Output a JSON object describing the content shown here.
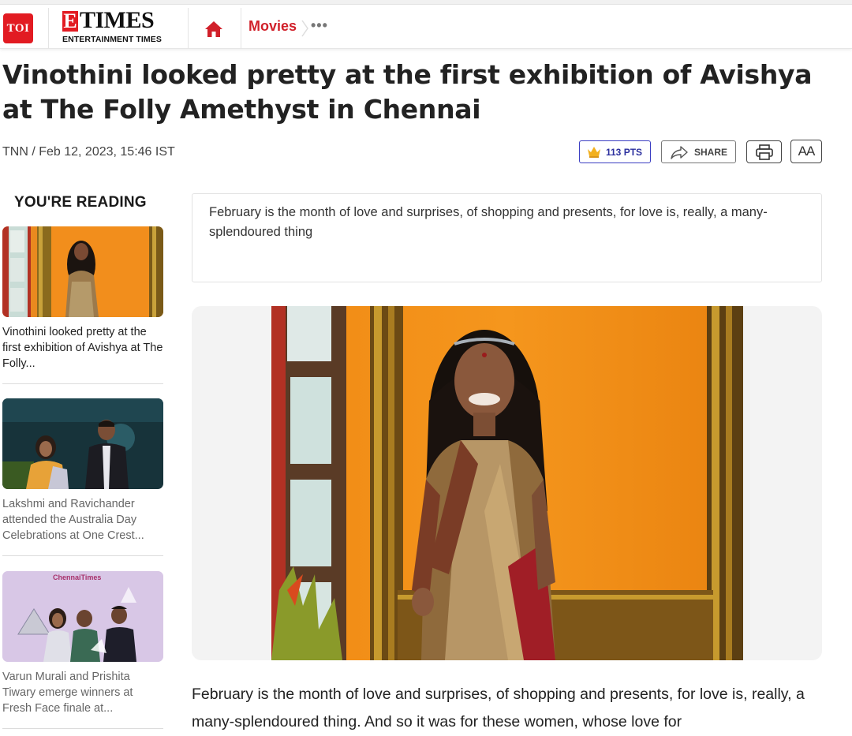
{
  "header": {
    "toi_logo": "TOI",
    "etimes_letter": "E",
    "etimes_word": "TIMES",
    "etimes_subtitle": "ENTERTAINMENT TIMES",
    "nav_movies": "Movies",
    "nav_more": "•••",
    "brand_color": "#e21b22"
  },
  "article": {
    "headline": "Vinothini looked pretty at the first exhibition of Avishya at The Folly Amethyst in Chennai",
    "byline": "TNN / Feb 12, 2023, 15:46 IST",
    "points": "113 PTS",
    "share_label": "SHARE",
    "font_size_label": "AA",
    "summary": "February is the month of love and surprises, of shopping and presents, for love is, really, a many-splendoured thing",
    "body": "February is the month of love and surprises, of shopping and presents, for love is, really, a many-splendoured thing. And so it was for these women, whose love for"
  },
  "sidebar": {
    "title": "YOU'RE READING",
    "items": [
      {
        "text": "Vinothini looked pretty at the first exhibition of Avishya at The Folly..."
      },
      {
        "text": "Lakshmi and Ravichander attended the Australia Day Celebrations at One Crest..."
      },
      {
        "text": "Varun Murali and Prishita Tiwary emerge winners at Fresh Face finale at...",
        "thumb_caption": "ChennaiTimes"
      }
    ]
  }
}
